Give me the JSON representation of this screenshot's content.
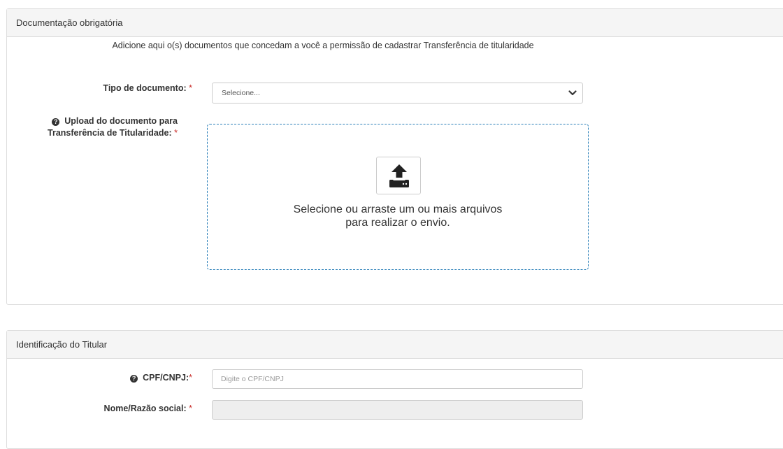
{
  "docs_panel": {
    "title": "Documentação obrigatória",
    "intro": "Adicione aqui o(s) documentos que concedam a você a permissão de cadastrar Transferência de titularidade",
    "doc_type": {
      "label": "Tipo de documento:",
      "required_mark": "*",
      "selected": "Selecione..."
    },
    "upload": {
      "label_line1": "Upload do documento para",
      "label_line2": "Transferência de Titularidade:",
      "required_mark": "*",
      "help_icon": "question-circle-icon",
      "drop_line1": "Selecione ou arraste um ou mais arquivos",
      "drop_line2": "para realizar o envio.",
      "button_icon": "upload-icon"
    }
  },
  "titular_panel": {
    "title": "Identificação do Titular",
    "cpf": {
      "label": "CPF/CNPJ:",
      "required_mark": "*",
      "placeholder": "Digite o CPF/CNPJ",
      "help_icon": "question-circle-icon"
    },
    "nome": {
      "label": "Nome/Razão social:",
      "required_mark": "*",
      "value": ""
    }
  },
  "colors": {
    "required": "#c9302c",
    "dropzone_border": "#2a7fb8",
    "heading_bg": "#f5f5f5"
  }
}
